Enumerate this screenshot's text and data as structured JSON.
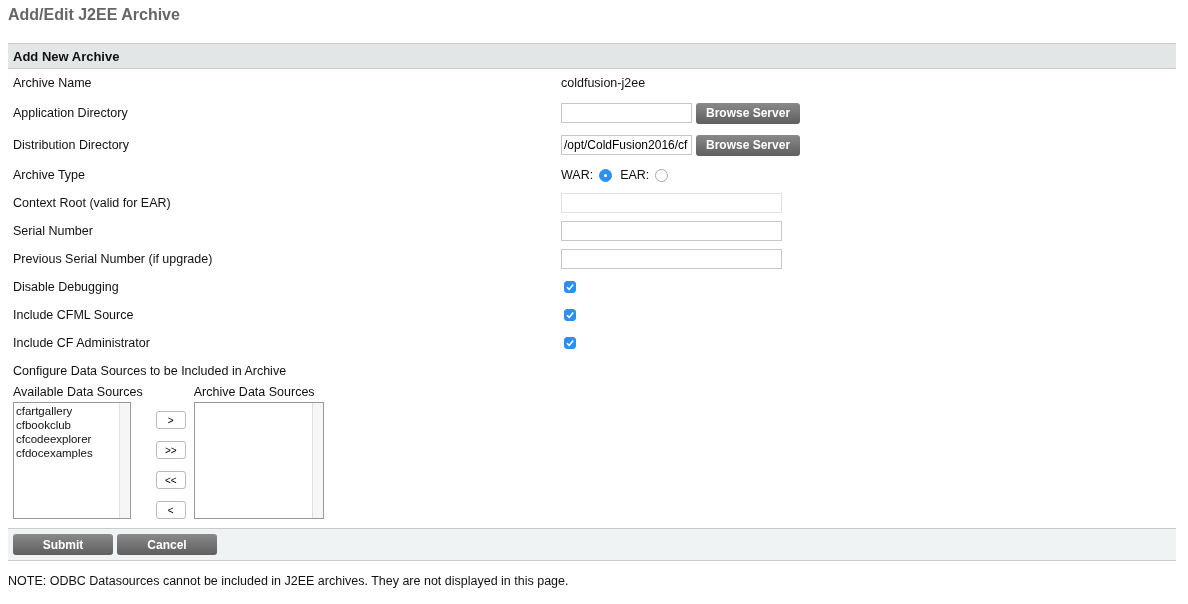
{
  "page_title": "Add/Edit J2EE Archive",
  "section_title": "Add New Archive",
  "rows": [
    {
      "kind": "text",
      "label": "Archive Name",
      "value": "coldfusion-j2ee"
    },
    {
      "kind": "browse",
      "label": "Application Directory",
      "button": "Browse Server"
    },
    {
      "kind": "browse",
      "label": "Distribution Directory",
      "value": "/opt/ColdFusion2016/cf",
      "button": "Browse Server"
    },
    {
      "kind": "radio",
      "label": "Archive Type",
      "options": [
        {
          "label": "WAR:",
          "selected": true
        },
        {
          "label": "EAR:",
          "selected": false
        }
      ]
    },
    {
      "kind": "input",
      "label": "Context Root (valid for EAR)",
      "disabled": true
    },
    {
      "kind": "input",
      "label": "Serial Number",
      "disabled": false
    },
    {
      "kind": "input",
      "label": "Previous Serial Number (if upgrade)",
      "disabled": false
    },
    {
      "kind": "checkbox",
      "label": "Disable Debugging",
      "checked": true
    },
    {
      "kind": "checkbox",
      "label": "Include CFML Source",
      "checked": true
    },
    {
      "kind": "checkbox",
      "label": "Include CF Administrator",
      "checked": true
    }
  ],
  "datasources": {
    "title": "Configure Data Sources to be Included in Archive",
    "available_label": "Available Data Sources",
    "available": [
      "cfartgallery",
      "cfbookclub",
      "cfcodeexplorer",
      "cfdocexamples"
    ],
    "archive_label": "Archive Data Sources",
    "move_buttons": [
      ">",
      ">>",
      "<<",
      "<"
    ]
  },
  "actions": [
    "Submit",
    "Cancel"
  ],
  "note": "NOTE: ODBC Datasources cannot be included in J2EE archives. They are not displayed in this page."
}
